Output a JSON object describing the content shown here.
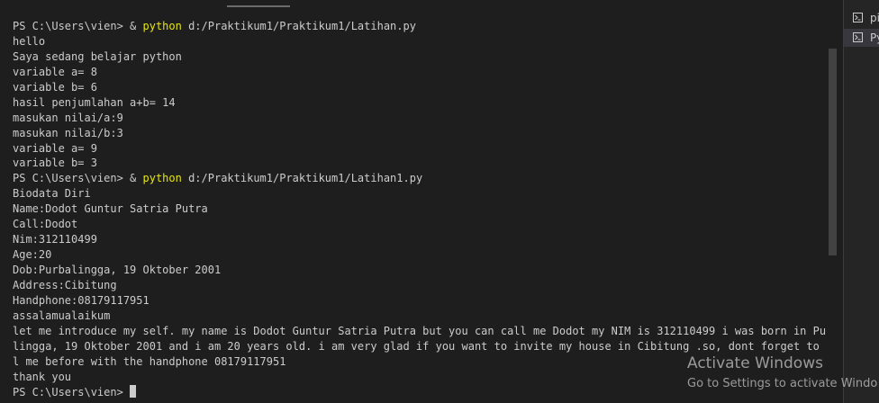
{
  "terminal": {
    "lines": [
      {
        "prefix": "PS C:\\Users\\vien> & ",
        "cmd": "python",
        "args": " d:/Praktikum1/Praktikum1/Latihan.py"
      },
      {
        "text": "hello"
      },
      {
        "text": "Saya sedang belajar python"
      },
      {
        "text": "variable a= 8"
      },
      {
        "text": "variable b= 6"
      },
      {
        "text": "hasil penjumlahan a+b= 14"
      },
      {
        "text": "masukan nilai/a:9"
      },
      {
        "text": "masukan nilai/b:3"
      },
      {
        "text": "variable a= 9"
      },
      {
        "text": "variable b= 3"
      },
      {
        "prefix": "PS C:\\Users\\vien> & ",
        "cmd": "python",
        "args": " d:/Praktikum1/Praktikum1/Latihan1.py"
      },
      {
        "text": "Biodata Diri"
      },
      {
        "text": "Name:Dodot Guntur Satria Putra"
      },
      {
        "text": "Call:Dodot"
      },
      {
        "text": "Nim:312110499"
      },
      {
        "text": "Age:20"
      },
      {
        "text": "Dob:Purbalingga, 19 Oktober 2001"
      },
      {
        "text": "Address:Cibitung"
      },
      {
        "text": "Handphone:08179117951"
      },
      {
        "text": "assalamualaikum"
      },
      {
        "text": "let me introduce my self. my name is Dodot Guntur Satria Putra but you can call me Dodot my NIM is 312110499 i was born in Purba"
      },
      {
        "text": "lingga, 19 Oktober 2001 and i am 20 years old. i am very glad if you want to invite my house in Cibitung .so, dont forget to cal"
      },
      {
        "text": "l me before with the handphone 08179117951"
      },
      {
        "text": "thank you"
      },
      {
        "prefix": "PS C:\\Users\\vien> ",
        "cursor": true
      }
    ]
  },
  "side_panel": {
    "items": [
      {
        "label": "pi",
        "icon": "terminal-icon",
        "active": false
      },
      {
        "label": "Py",
        "icon": "terminal-icon",
        "active": true
      }
    ]
  },
  "watermark": {
    "title": "Activate Windows",
    "subtitle": "Go to Settings to activate Windo"
  },
  "colors": {
    "background": "#1e1e1e",
    "text": "#cccccc",
    "command": "#e5e510",
    "side_panel": "#252526"
  }
}
